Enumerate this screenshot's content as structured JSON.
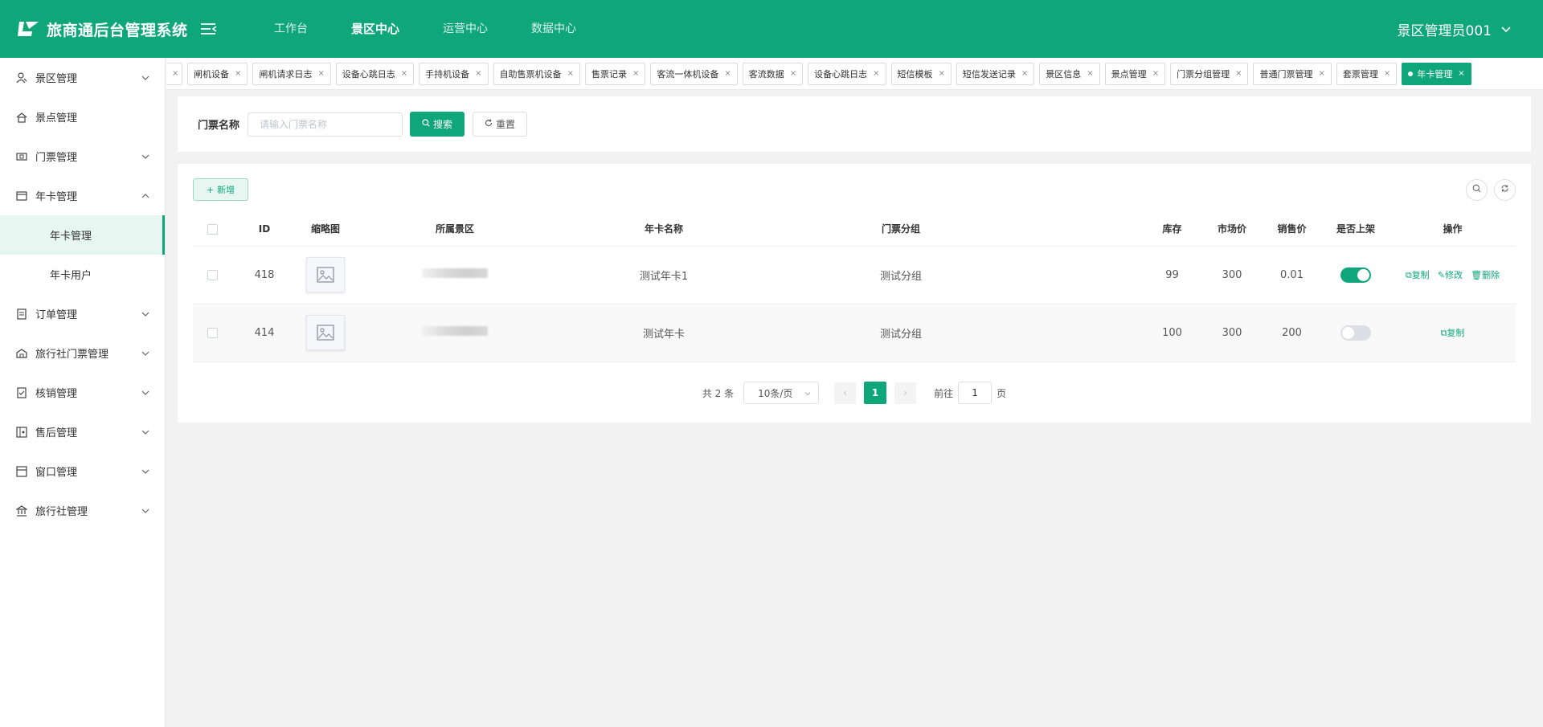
{
  "header": {
    "app_title": "旅商通后台管理系统",
    "nav": [
      "工作台",
      "景区中心",
      "运营中心",
      "数据中心"
    ],
    "nav_active_index": 1,
    "user": "景区管理员001"
  },
  "sidebar": {
    "items": [
      {
        "label": "景区管理",
        "icon": "ticket-person-icon",
        "arrow": "down"
      },
      {
        "label": "景点管理",
        "icon": "home-icon",
        "arrow": ""
      },
      {
        "label": "门票管理",
        "icon": "ticket-icon",
        "arrow": "down"
      },
      {
        "label": "年卡管理",
        "icon": "card-icon",
        "arrow": "up"
      },
      {
        "label": "订单管理",
        "icon": "order-icon",
        "arrow": "down"
      },
      {
        "label": "旅行社门票管理",
        "icon": "agency-ticket-icon",
        "arrow": "down"
      },
      {
        "label": "核销管理",
        "icon": "verify-icon",
        "arrow": "down"
      },
      {
        "label": "售后管理",
        "icon": "aftersale-icon",
        "arrow": "down"
      },
      {
        "label": "窗口管理",
        "icon": "window-icon",
        "arrow": "down"
      },
      {
        "label": "旅行社管理",
        "icon": "bank-icon",
        "arrow": "down"
      }
    ],
    "sub_items": [
      "年卡管理",
      "年卡用户"
    ],
    "active_sub": "年卡管理"
  },
  "tabs": [
    {
      "label": "",
      "closable": true
    },
    {
      "label": "闸机设备",
      "closable": true
    },
    {
      "label": "闸机请求日志",
      "closable": true
    },
    {
      "label": "设备心跳日志",
      "closable": true
    },
    {
      "label": "手持机设备",
      "closable": true
    },
    {
      "label": "自助售票机设备",
      "closable": true
    },
    {
      "label": "售票记录",
      "closable": true
    },
    {
      "label": "客流一体机设备",
      "closable": true
    },
    {
      "label": "客流数据",
      "closable": true
    },
    {
      "label": "设备心跳日志",
      "closable": true
    },
    {
      "label": "短信模板",
      "closable": true
    },
    {
      "label": "短信发送记录",
      "closable": true
    },
    {
      "label": "景区信息",
      "closable": true
    },
    {
      "label": "景点管理",
      "closable": true
    },
    {
      "label": "门票分组管理",
      "closable": true
    },
    {
      "label": "普通门票管理",
      "closable": true
    },
    {
      "label": "套票管理",
      "closable": true
    },
    {
      "label": "年卡管理",
      "closable": true,
      "active": true
    }
  ],
  "search": {
    "label": "门票名称",
    "placeholder": "请输入门票名称",
    "value": "",
    "search_btn": "搜索",
    "reset_btn": "重置"
  },
  "toolbar": {
    "add_btn": "新增"
  },
  "table": {
    "columns": [
      "ID",
      "缩略图",
      "所属景区",
      "年卡名称",
      "门票分组",
      "库存",
      "市场价",
      "销售价",
      "是否上架",
      "操作"
    ],
    "rows": [
      {
        "id": "418",
        "scenic": "",
        "name": "测试年卡1",
        "group": "测试分组",
        "stock": "99",
        "market_price": "300",
        "sale_price": "0.01",
        "on_sale": true,
        "ops": [
          "复制",
          "修改",
          "删除"
        ]
      },
      {
        "id": "414",
        "scenic": "",
        "name": "测试年卡",
        "group": "测试分组",
        "stock": "100",
        "market_price": "300",
        "sale_price": "200",
        "on_sale": false,
        "ops": [
          "复制"
        ]
      }
    ]
  },
  "pagination": {
    "total_text": "共 2 条",
    "page_size": "10条/页",
    "current_page": "1",
    "goto_label": "前往",
    "goto_value": "1",
    "page_unit": "页"
  },
  "colors": {
    "primary": "#0fa67a"
  }
}
